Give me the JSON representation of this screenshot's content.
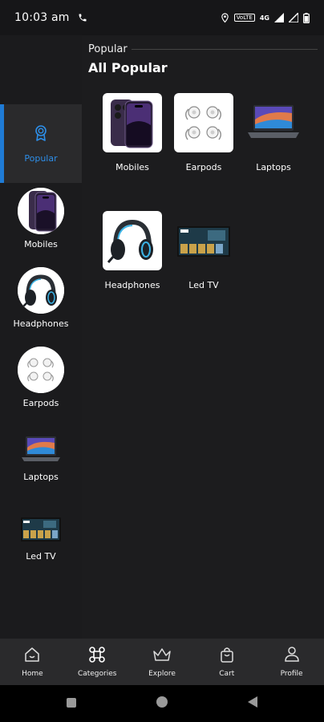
{
  "status": {
    "time": "10:03 am",
    "network": "4G",
    "volte": "VoLTE"
  },
  "colors": {
    "accent": "#1f7bd6",
    "background": "#1c1c1e",
    "nav_background": "#2a2a2c"
  },
  "sidebar": {
    "items": [
      {
        "label": "Popular",
        "icon": "award-icon",
        "active": true
      },
      {
        "label": "Mobiles"
      },
      {
        "label": "Headphones"
      },
      {
        "label": "Earpods"
      },
      {
        "label": "Laptops"
      },
      {
        "label": "Led TV"
      }
    ]
  },
  "main": {
    "section_header": "Popular",
    "title": "All Popular",
    "grid": [
      {
        "label": "Mobiles"
      },
      {
        "label": "Earpods"
      },
      {
        "label": "Laptops"
      },
      {
        "label": "Headphones"
      },
      {
        "label": "Led TV"
      }
    ]
  },
  "bottom_nav": {
    "items": [
      {
        "label": "Home",
        "icon": "home-icon"
      },
      {
        "label": "Categories",
        "icon": "categories-icon"
      },
      {
        "label": "Explore",
        "icon": "crown-icon"
      },
      {
        "label": "Cart",
        "icon": "bag-icon"
      },
      {
        "label": "Profile",
        "icon": "user-icon"
      }
    ]
  },
  "system_nav": {
    "icons": [
      "square-icon",
      "circle-icon",
      "triangle-back-icon"
    ]
  }
}
